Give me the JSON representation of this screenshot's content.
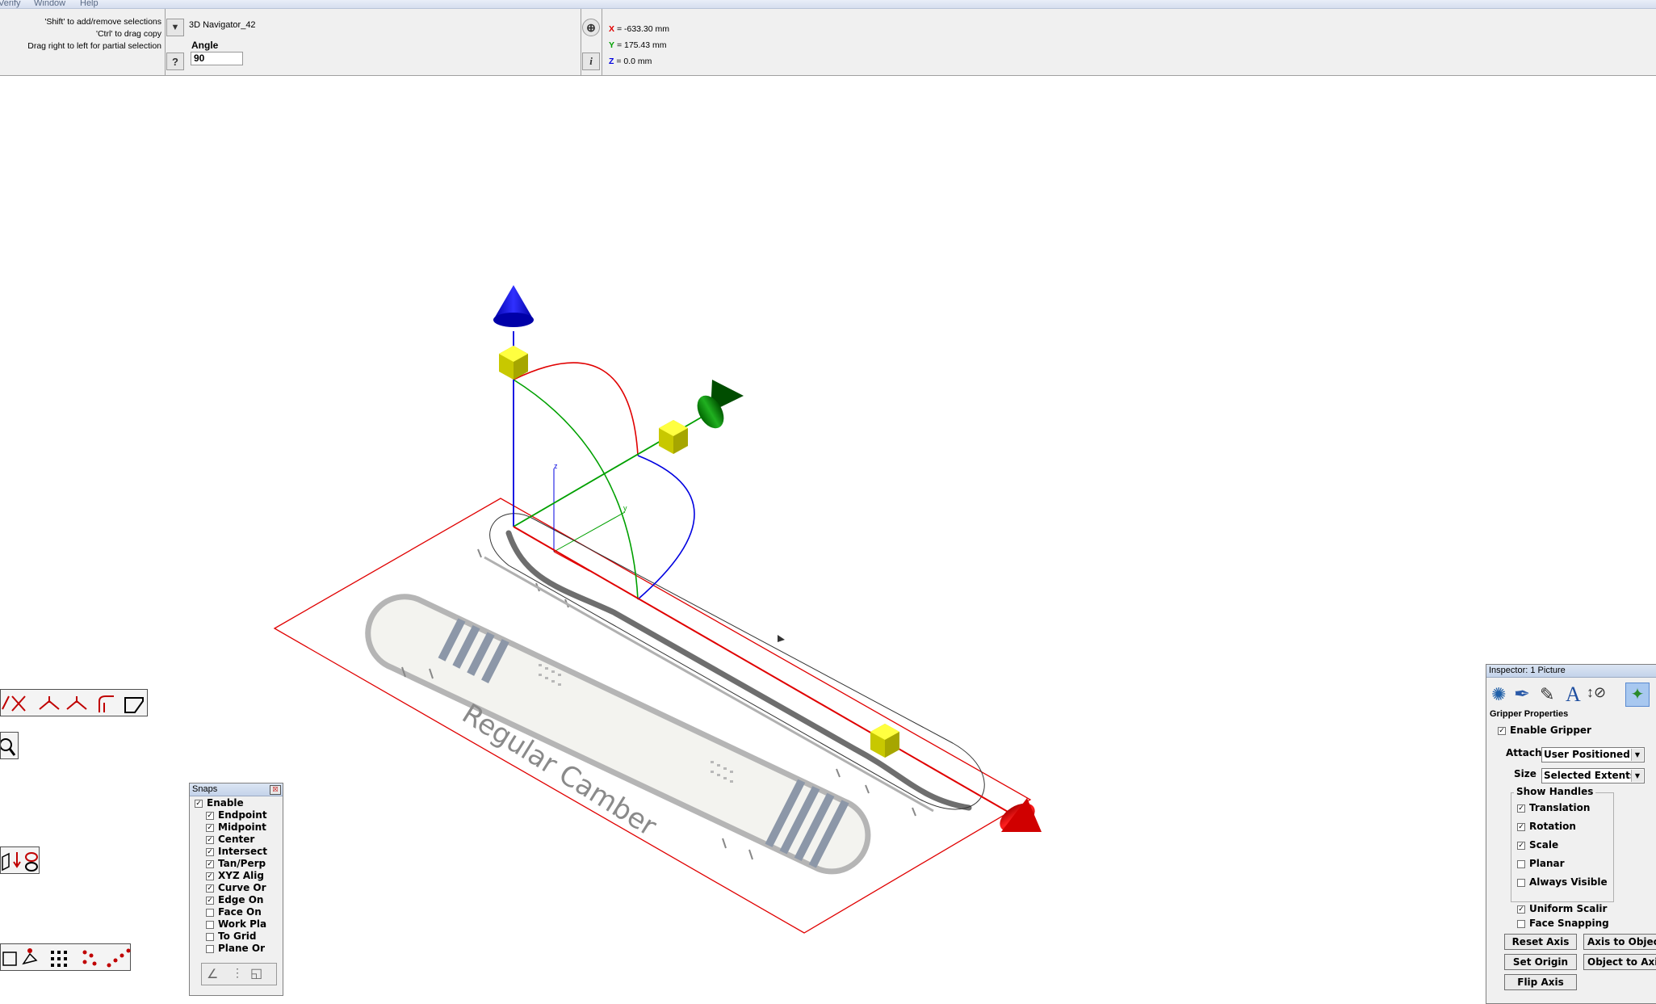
{
  "menu": [
    "Verify",
    "Window",
    "Help"
  ],
  "toolbar": {
    "hints": [
      "'Shift' to add/remove selections",
      "'Ctrl' to drag copy",
      "Drag right to left for partial selection"
    ],
    "object_name": "3D Navigator_42",
    "angle_label": "Angle",
    "angle_value": "90",
    "help_button": "?",
    "info_button": "i",
    "coords": {
      "x_label": "X",
      "x_value": "= -633.30 mm",
      "y_label": "Y",
      "y_value": "= 175.43 mm",
      "z_label": "Z",
      "z_value": "= 0.0 mm"
    }
  },
  "canvas": {
    "board_text": "Regular Camber",
    "axis_x": "x",
    "axis_y": "y",
    "axis_z": "z",
    "colors": {
      "x_axis": "#ff0000",
      "y_axis": "#00a000",
      "z_axis": "#0000e0",
      "handle": "#e6e600"
    }
  },
  "snaps": {
    "title": "Snaps",
    "enable": "Enable",
    "items": [
      {
        "label": "Endpoint",
        "checked": true
      },
      {
        "label": "Midpoint",
        "checked": true
      },
      {
        "label": "Center",
        "checked": true
      },
      {
        "label": "Intersect",
        "checked": true
      },
      {
        "label": "Tan/Perp",
        "checked": true
      },
      {
        "label": "XYZ Alig",
        "checked": true
      },
      {
        "label": "Curve Or",
        "checked": true
      },
      {
        "label": "Edge On",
        "checked": true
      },
      {
        "label": "Face On",
        "checked": false
      },
      {
        "label": "Work Pla",
        "checked": false
      },
      {
        "label": "To Grid",
        "checked": false
      },
      {
        "label": "Plane Or",
        "checked": false
      }
    ]
  },
  "inspector": {
    "title": "Inspector: 1 Picture",
    "section": "Gripper Properties",
    "enable_gripper": "Enable Gripper",
    "attach_label": "Attach",
    "attach_value": "User Positioned",
    "size_label": "Size",
    "size_value": "Selected Extents",
    "show_handles_label": "Show Handles",
    "handles": [
      {
        "label": "Translation",
        "checked": true
      },
      {
        "label": "Rotation",
        "checked": true
      },
      {
        "label": "Scale",
        "checked": true
      },
      {
        "label": "Planar",
        "checked": false
      },
      {
        "label": "Always Visible",
        "checked": false
      }
    ],
    "uniform_scaling": "Uniform Scalir",
    "face_snapping": "Face Snapping",
    "buttons": {
      "reset_axis": "Reset Axis",
      "axis_to_object": "Axis to Objec",
      "set_origin": "Set Origin",
      "object_to_axis": "Object to Axis",
      "flip_axis": "Flip Axis"
    }
  }
}
